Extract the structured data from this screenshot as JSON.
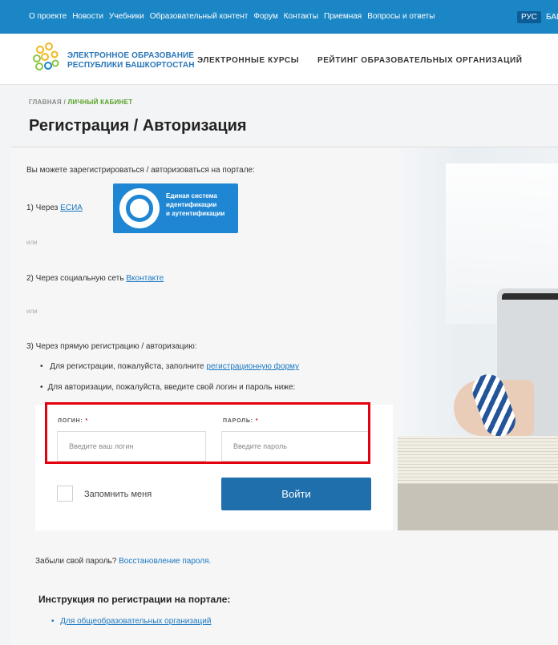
{
  "topbar": {
    "links": [
      "О проекте",
      "Новости",
      "Учебники",
      "Образовательный контент",
      "Форум",
      "Контакты",
      "Приемная",
      "Вопросы и ответы"
    ],
    "lang_ru": "РУС",
    "lang_ba": "БАШ"
  },
  "header": {
    "logo_line1": "ЭЛЕКТРОННОЕ ОБРАЗОВАНИЕ",
    "logo_line2": "РЕСПУБЛИКИ БАШКОРТОСТАН",
    "nav_courses": "ЭЛЕКТРОННЫЕ КУРСЫ",
    "nav_rating": "РЕЙТИНГ ОБРАЗОВАТЕЛЬНЫХ ОРГАНИЗАЦИЙ"
  },
  "breadcrumb": {
    "home": "ГЛАВНАЯ",
    "sep": "/",
    "current": "ЛИЧНЫЙ КАБИНЕТ"
  },
  "page_title": "Регистрация / Авторизация",
  "intro": "Вы можете зарегистрироваться / авторизоваться на портале:",
  "option1": {
    "prefix": "1) Через",
    "link": "ЕСИА"
  },
  "esia_logo": {
    "line1": "Единая система",
    "line2": "идентификации",
    "line3": "и аутентификации"
  },
  "or1": "или",
  "option2": {
    "prefix": "2) Через социальную сеть",
    "link": "Вконтакте"
  },
  "or2": "или",
  "option3": "3) Через прямую регистрацию / авторизацию:",
  "bullet1": {
    "prefix": "Для регистрации, пожалуйста, заполните",
    "link": "регистрационную форму"
  },
  "bullet2": "Для авторизации, пожалуйста, введите свой логин и пароль ниже:",
  "login_form": {
    "login_label": "ЛОГИН:",
    "password_label": "ПАРОЛЬ:",
    "required_mark": "*",
    "login_placeholder": "Введите ваш логин",
    "password_placeholder": "Введите пароль",
    "remember_label": "Запомнить меня",
    "submit_label": "Войти"
  },
  "forgot": {
    "prefix": "Забыли свой пароль?",
    "link": "Восстановление пароля."
  },
  "instructions": {
    "title": "Инструкция по регистрации на портале:",
    "item": "Для общеобразовательных организаций"
  },
  "colors": {
    "topbar": "#1a86c5",
    "accent": "#1f6fad",
    "highlight": "#e3000f",
    "breadcrumb_current": "#52a020"
  }
}
